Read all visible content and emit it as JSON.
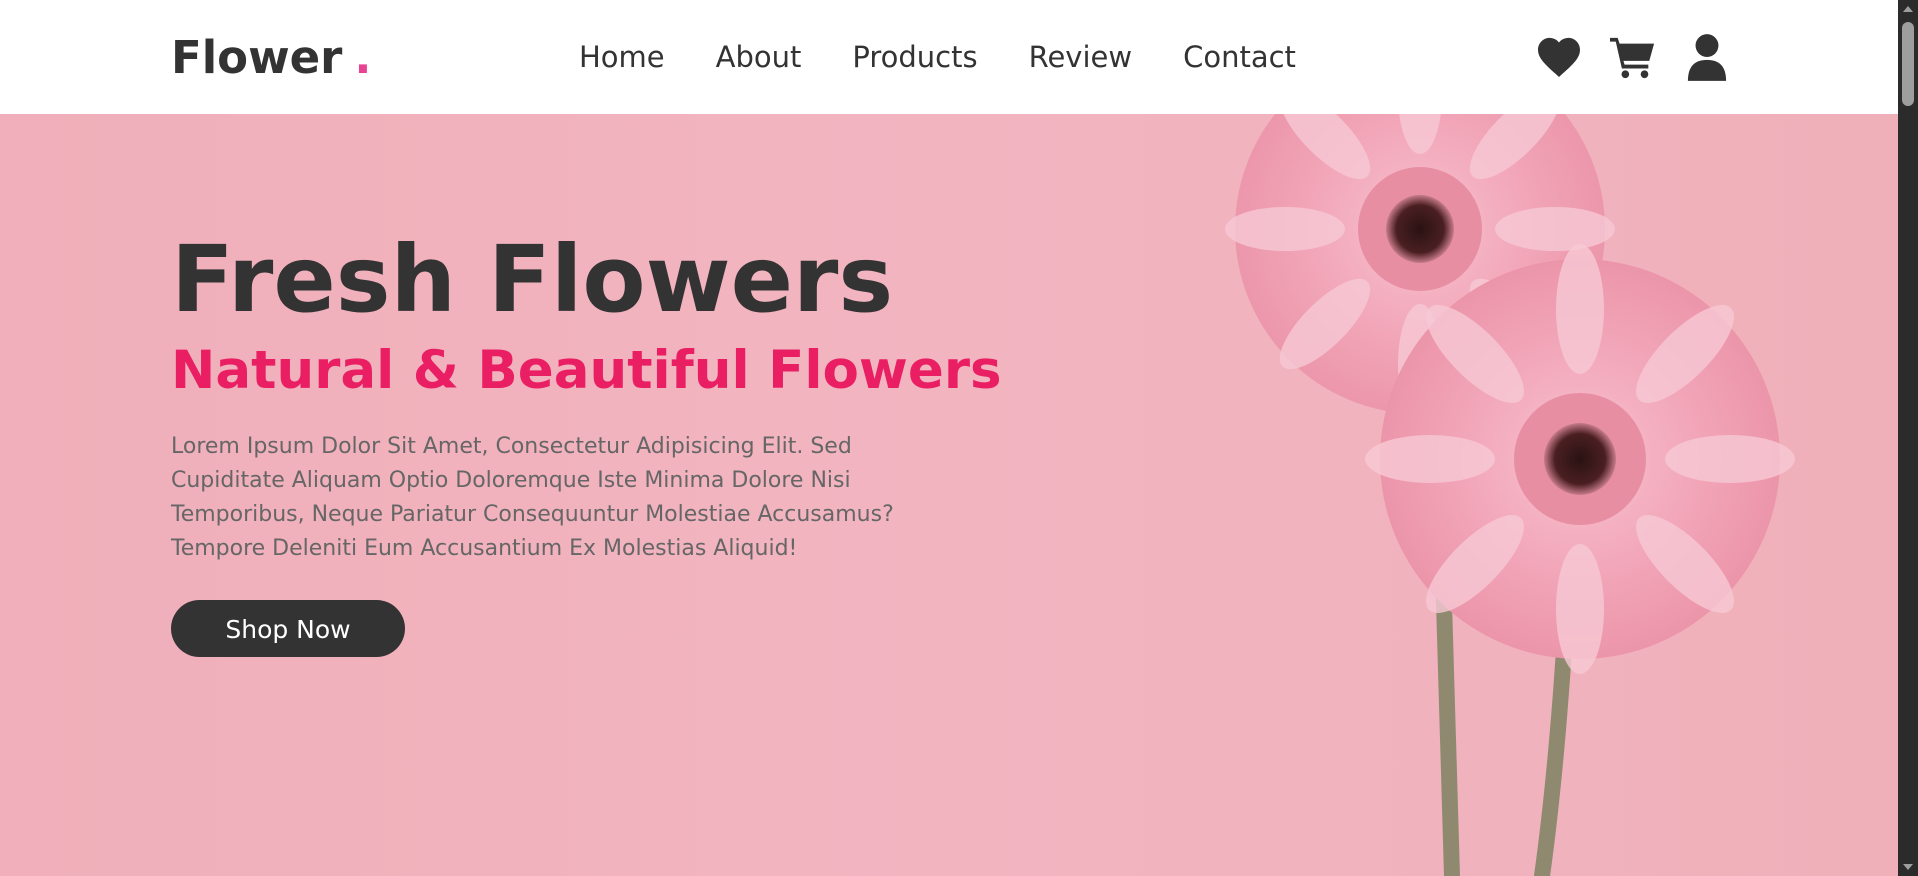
{
  "brand": {
    "name": "Flower",
    "dot": ".",
    "accent_color": "#e84393"
  },
  "nav": {
    "items": [
      {
        "label": "Home"
      },
      {
        "label": "About"
      },
      {
        "label": "Products"
      },
      {
        "label": "Review"
      },
      {
        "label": "Contact"
      }
    ]
  },
  "header_icons": [
    "heart-icon",
    "cart-icon",
    "user-icon"
  ],
  "hero": {
    "title": "Fresh Flowers",
    "subtitle": "Natural & Beautiful Flowers",
    "text": "Lorem Ipsum Dolor Sit Amet, Consectetur Adipisicing Elit. Sed Cupiditate Aliquam Optio Doloremque Iste Minima Dolore Nisi Temporibus, Neque Pariatur Consequuntur Molestiae Accusamus? Tempore Deleniti Eum Accusantium Ex Molestias Aliquid!",
    "button_label": "Shop Now",
    "subtitle_color": "#e91e63",
    "background_color": "#f1b3bc"
  }
}
